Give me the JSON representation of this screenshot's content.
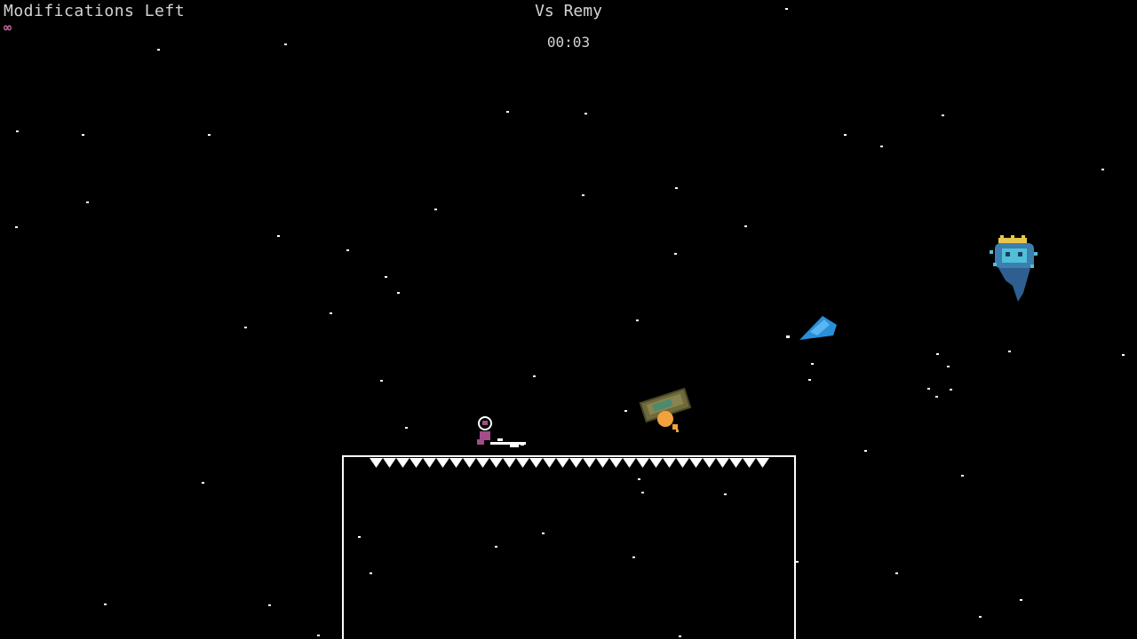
{
  "hud": {
    "modifications_label": "Modifications Left",
    "modifications_value": "∞",
    "boss_title": "Vs Remy",
    "timer": "00:03"
  },
  "colors": {
    "background": "#000000",
    "hud_text": "#d4d4d4",
    "infinity": "#c56aa0",
    "platform": "#ffffff",
    "player_head": "#ffffff",
    "player_body": "#a34c8a",
    "cannon_body": "#6e6a3a",
    "cannon_fire": "#f2a23c",
    "projectile": "#2a8fd8",
    "boss_body": "#3a7fb0",
    "boss_crown": "#e8c64a"
  },
  "sprites": {
    "player": "astronaut-player-icon",
    "cannon": "cannon-icon",
    "projectile": "blue-shard-projectile-icon",
    "boss": "crowned-ghost-boss-icon",
    "platform": "spiked-platform"
  }
}
